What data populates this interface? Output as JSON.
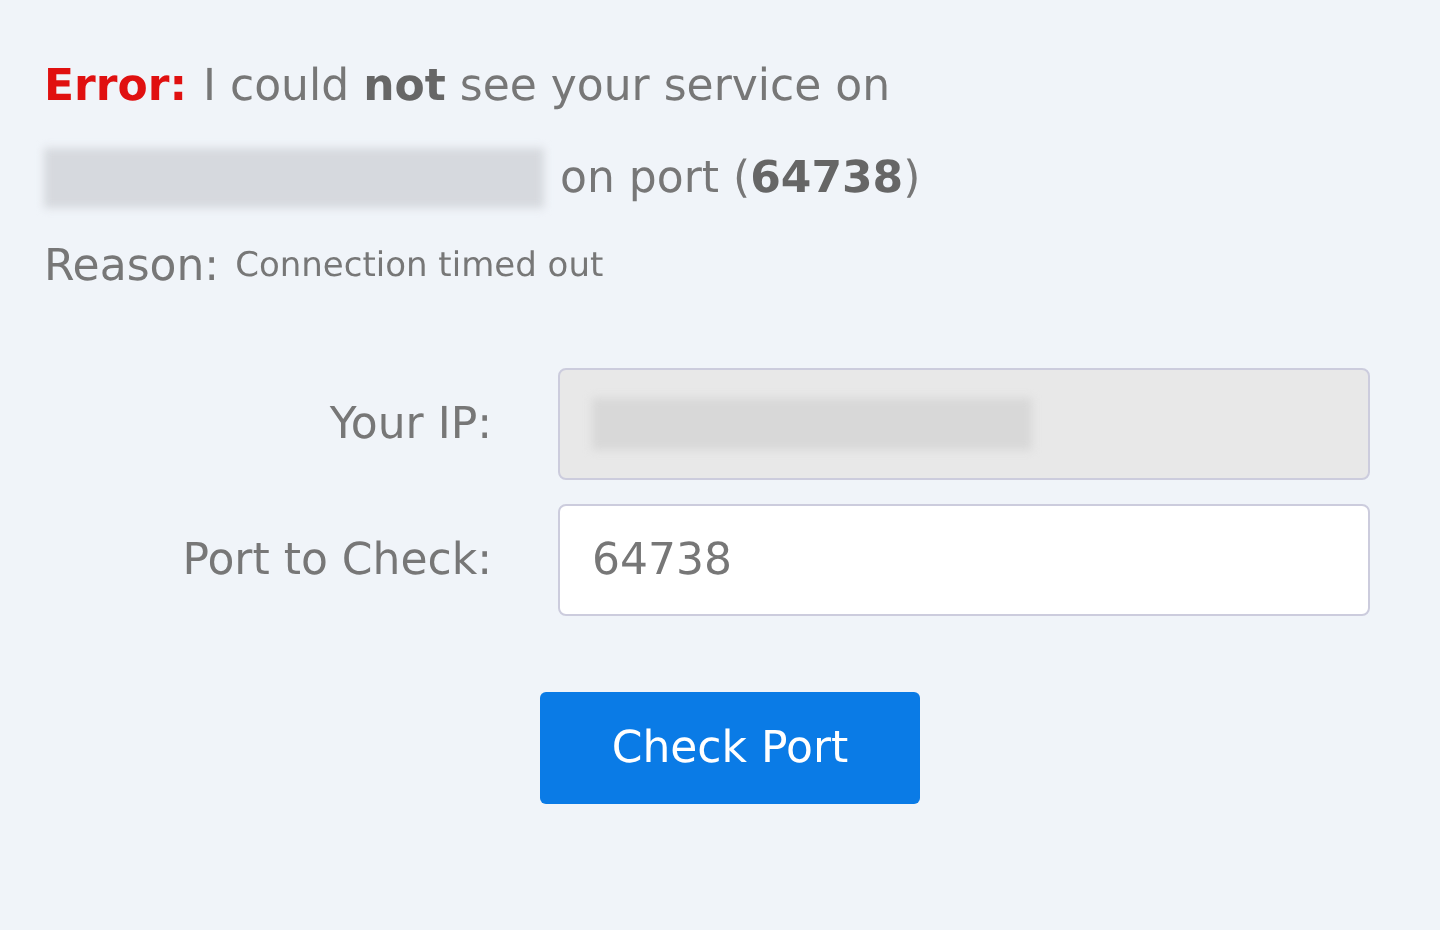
{
  "error": {
    "label": "Error:",
    "message": "I could **not** see your service on",
    "message_2": "on port (**64738**)"
  },
  "reason": {
    "label": "Reason:",
    "text": "Connection timed out"
  },
  "form": {
    "fields": [
      {
        "label": "Your IP:",
        "disabled": true
      },
      {
        "label": "Port to Check:",
        "value": "64738",
        "disabled": false
      }
    ],
    "button": "Check Port"
  }
}
